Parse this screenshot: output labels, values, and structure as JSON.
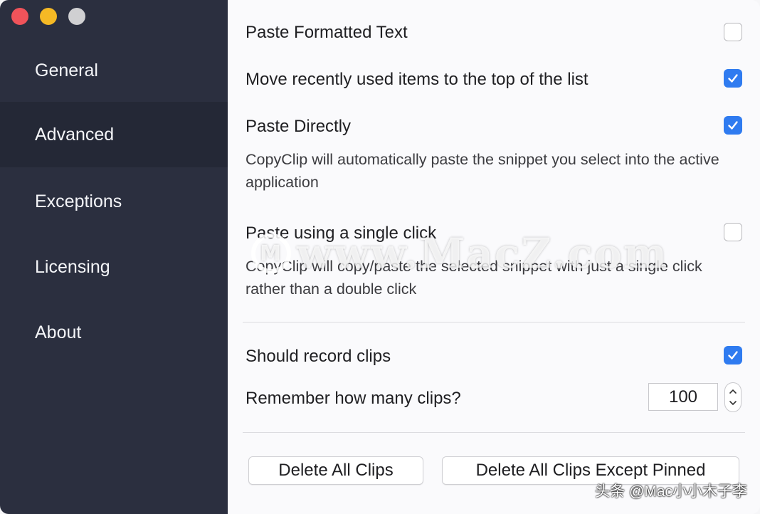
{
  "window": {
    "traffic_lights": [
      "close",
      "minimize",
      "zoom"
    ]
  },
  "sidebar": {
    "items": [
      {
        "label": "General",
        "active": false
      },
      {
        "label": "Advanced",
        "active": true
      },
      {
        "label": "Exceptions",
        "active": false
      },
      {
        "label": "Licensing",
        "active": false
      },
      {
        "label": "About",
        "active": false
      }
    ]
  },
  "settings": {
    "paste_formatted": {
      "label": "Paste Formatted Text",
      "checked": false
    },
    "move_recent": {
      "label": "Move recently used items to the top of the list",
      "checked": true
    },
    "paste_directly": {
      "label": "Paste Directly",
      "checked": true,
      "description": "CopyClip will automatically paste the snippet you select into the active application"
    },
    "single_click": {
      "label": "Paste using a single click",
      "checked": false,
      "description": "CopyClip will copy/paste the selected snippet with just a single click rather than a double click"
    },
    "record_clips": {
      "label": "Should record clips",
      "checked": true
    },
    "remember_count": {
      "label": "Remember how many clips?",
      "value": "100"
    }
  },
  "buttons": {
    "delete_all": "Delete All Clips",
    "delete_except_pinned": "Delete All Clips Except Pinned"
  },
  "overlays": {
    "watermark": "www.MacZ.com",
    "watermark_logo": "M",
    "credit": "头条 @Mac小小木子李"
  },
  "colors": {
    "sidebar_bg": "#2b2f3f",
    "sidebar_active": "#242836",
    "checkbox_accent": "#2f7bf0"
  }
}
